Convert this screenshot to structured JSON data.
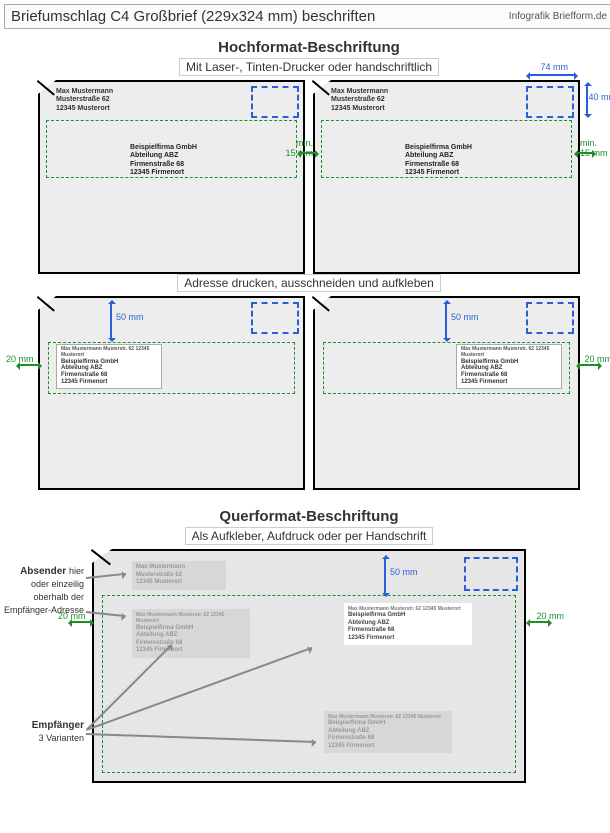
{
  "header": {
    "title": "Briefumschlag C4 Großbrief (229x324 mm) beschriften",
    "source": "Infografik Briefform.de"
  },
  "hoch": {
    "heading": "Hochformat-Beschriftung",
    "sub1": "Mit Laser-, Tinten-Drucker oder handschriftlich",
    "sub2": "Adresse drucken, ausschneiden und aufkleben"
  },
  "quer": {
    "heading": "Querformat-Beschriftung",
    "sub": "Als Aufkleber, Aufdruck oder per Handschrift",
    "absender_label": "Absender hier oder einzeilig oberhalb der Empfänger-Adresse",
    "empf_label": "Empfänger",
    "empf_sub": "3 Varianten"
  },
  "sender": {
    "l1": "Max Mustermann",
    "l2": "Musterstraße 62",
    "l3": "12345 Musterort"
  },
  "sender_line": "Max Mustermann Musterstr. 62 12345 Musterort",
  "recipient": {
    "l1": "Beispielfirma GmbH",
    "l2": "Abteilung ABZ",
    "l3": "Firmenstraße 68",
    "l4": "12345 Firmenort"
  },
  "dims": {
    "stamp_w": "74 mm",
    "stamp_h": "40 mm",
    "margin_min": "min. 15 mm",
    "label_top": "50 mm",
    "label_left": "20 mm"
  }
}
